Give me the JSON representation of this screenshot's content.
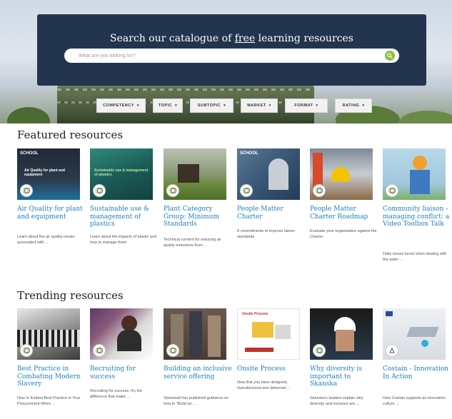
{
  "search": {
    "title_prefix": "Search our catalogue of ",
    "title_emphasis": "free",
    "title_suffix": " learning resources",
    "placeholder": "What are you looking for?"
  },
  "filters": [
    "COMPETENCY",
    "TOPIC",
    "SUBTOPIC",
    "MARKET",
    "FORMAT",
    "RATING"
  ],
  "featured": {
    "heading": "Featured resources",
    "items": [
      {
        "title": "Air Quality for plant and equipment",
        "desc": "Learn about the air quality issues associated with ...",
        "thumb_label": "Air Quality for plant and equipment",
        "logo": "SCHOOL"
      },
      {
        "title": "Sustainable use & management of plastics",
        "desc": "Learn about the impacts of plastic and how to manage them",
        "thumb_label": "Sustainable use & management of plastics"
      },
      {
        "title": "Plant Category Group: Minimum Standards",
        "desc": "Technical content for reducing air quality emissions from..."
      },
      {
        "title": "People Matter Charter",
        "desc": "8 commitments to improve labour standards",
        "logo": "SCHOOL"
      },
      {
        "title": "People Matter Charter Roadmap",
        "desc": "Evaluate your organisation against the Charter"
      },
      {
        "title": "Community liaison - managing conflict: a Video Toolbox Talk",
        "desc": "Daily issues faced when dealing with the wider ..."
      }
    ]
  },
  "trending": {
    "heading": "Trending resources",
    "items": [
      {
        "title": "Best Practice in Combating Modern Slavery",
        "desc": "How to Embed Best Practice in Your Procurement When ..."
      },
      {
        "title": "Recruiting for success",
        "desc": "Recruiting for success. It's the difference that make ..."
      },
      {
        "title": "Building an inclusive service offering",
        "desc": "Stonewall has published guidance on how to \"Build an ..."
      },
      {
        "title": "Onsite Process",
        "desc": "Now that you have designed, manufactured and delivered ...",
        "thumb_label": "Onsite Process"
      },
      {
        "title": "Why diversity is important to Skanska",
        "desc": "Skanska's leaders explain why diversity and inclusion are ..."
      },
      {
        "title": "Costain - Innovation In Action",
        "desc": "How Costain supports an innovation culture ..."
      }
    ]
  },
  "colors": {
    "panel": "#23344e",
    "link": "#1d7fc2",
    "search_button": "#8fc04a"
  },
  "icons": {
    "search": "search-icon",
    "badge": "rating-badge-icon"
  }
}
